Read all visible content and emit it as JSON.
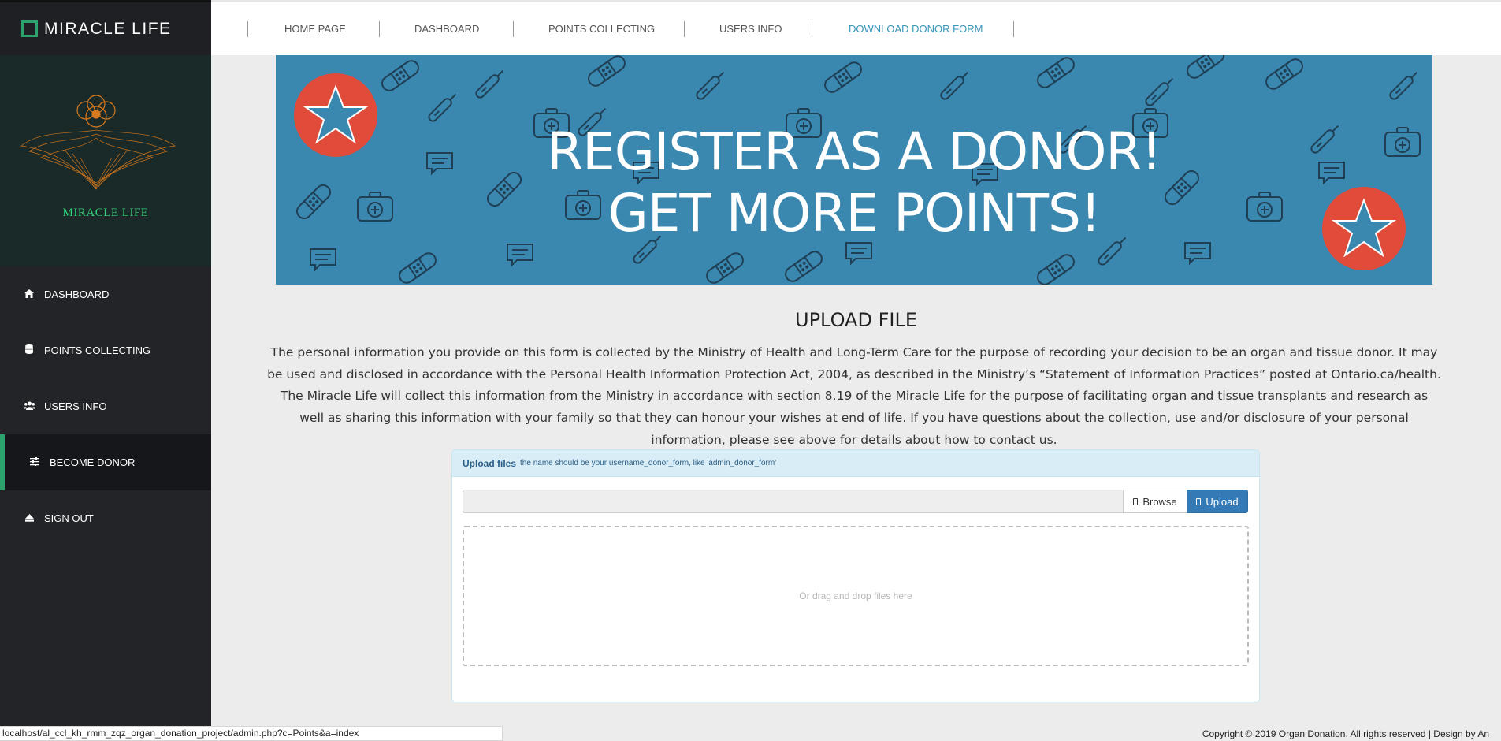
{
  "brand": {
    "title": "MIRACLE LIFE",
    "logo_text": "MIRACLE LIFE"
  },
  "sidebar": {
    "items": [
      {
        "label": "DASHBOARD",
        "icon": "home-icon"
      },
      {
        "label": "POINTS COLLECTING",
        "icon": "database-icon"
      },
      {
        "label": "USERS INFO",
        "icon": "users-icon"
      },
      {
        "label": "BECOME DONOR",
        "icon": "sliders-icon",
        "active": true
      },
      {
        "label": "SIGN OUT",
        "icon": "eject-icon"
      }
    ]
  },
  "topnav": {
    "links": [
      {
        "label": "HOME PAGE"
      },
      {
        "label": "DASHBOARD"
      },
      {
        "label": "POINTS COLLECTING"
      },
      {
        "label": "USERS INFO"
      },
      {
        "label": "DOWNLOAD DONOR FORM",
        "accent": true
      }
    ]
  },
  "banner": {
    "line1": "REGISTER AS A DONOR!",
    "line2": "GET MORE POINTS!"
  },
  "upload": {
    "title": "UPLOAD FILE",
    "description": "The personal information you provide on this form is collected by the Ministry of Health and Long-Term Care for the purpose of recording your decision to be an organ and tissue donor. It may be used and disclosed in accordance with the Personal Health Information Protection Act, 2004, as described in the Ministry’s “Statement of Information Practices” posted at Ontario.ca/health. The Miracle Life will collect this information from the Ministry in accordance with section 8.19 of the Miracle Life for the purpose of facilitating organ and tissue transplants and research as well as sharing this information with your family so that they can honour your wishes at end of life. If you have questions about the collection, use and/or disclosure of your personal information, please see above for details about how to contact us.",
    "panel_title": "Upload files",
    "panel_hint": "the name should be your username_donor_form, like 'admin_donor_form'",
    "browse_label": "Browse",
    "upload_label": "Upload",
    "drop_text": "Or drag and drop files here"
  },
  "status_url": "localhost/al_ccl_kh_rmm_zqz_organ_donation_project/admin.php?c=Points&a=index",
  "footer": "Copyright © 2019 Organ Donation. All rights reserved | Design by An",
  "colors": {
    "sidebar_bg": "#222428",
    "accent_green": "#2ca36c",
    "banner_blue": "#3a87b0",
    "banner_badge_red": "#e04b3a",
    "primary_button": "#337ab7",
    "nav_accent": "#3b95b8"
  }
}
